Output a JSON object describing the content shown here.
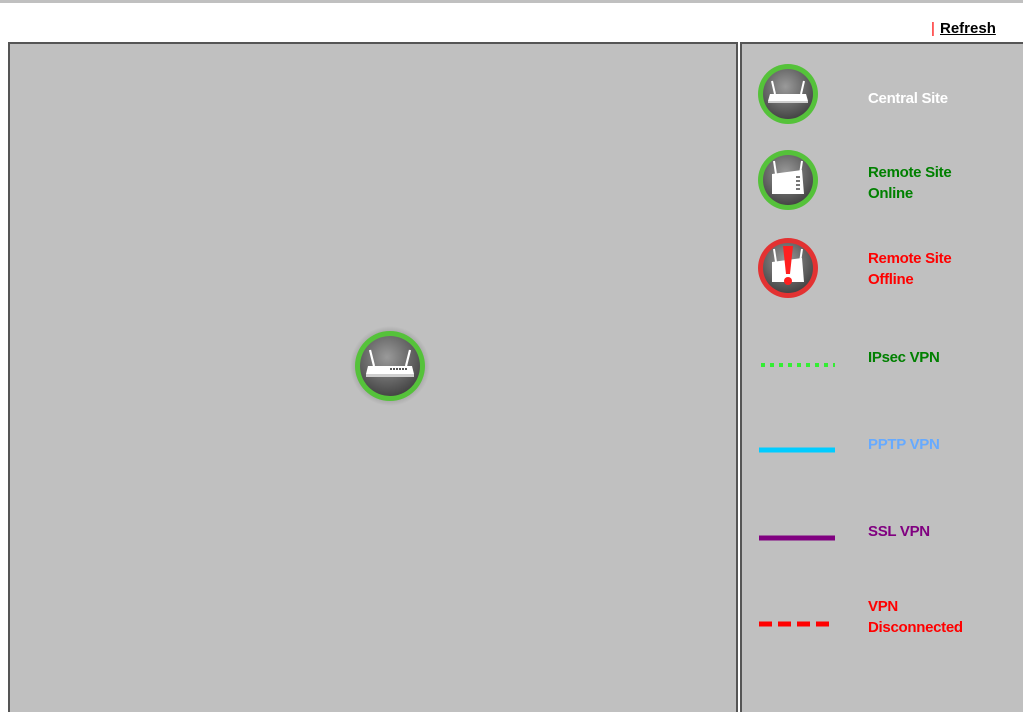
{
  "toolbar": {
    "separator": "|",
    "refresh_label": "Refresh"
  },
  "map": {
    "nodes": [
      {
        "type": "central-site",
        "icon": "router-icon",
        "status_color": "#55c23a"
      }
    ]
  },
  "legend": {
    "central_site": {
      "label": "Central Site",
      "color": "#ffffff",
      "icon": "router-icon"
    },
    "remote_online": {
      "label_line1": "Remote Site",
      "label_line2": "Online",
      "color": "#008000",
      "icon": "remote-router-icon"
    },
    "remote_offline": {
      "label_line1": "Remote Site",
      "label_line2": "Offline",
      "color": "#ff0000",
      "icon": "remote-router-alert-icon"
    },
    "ipsec": {
      "label": "IPsec VPN",
      "color": "#008000",
      "line_color": "#33ee33",
      "line_style": "dotted"
    },
    "pptp": {
      "label": "PPTP VPN",
      "color": "#66aaff",
      "line_color": "#00ccff",
      "line_style": "solid"
    },
    "ssl": {
      "label": "SSL VPN",
      "color": "#800080",
      "line_color": "#800080",
      "line_style": "solid"
    },
    "disconnected": {
      "label_line1": "VPN",
      "label_line2": "Disconnected",
      "color": "#ff0000",
      "line_color": "#ff0000",
      "line_style": "dashed"
    }
  }
}
